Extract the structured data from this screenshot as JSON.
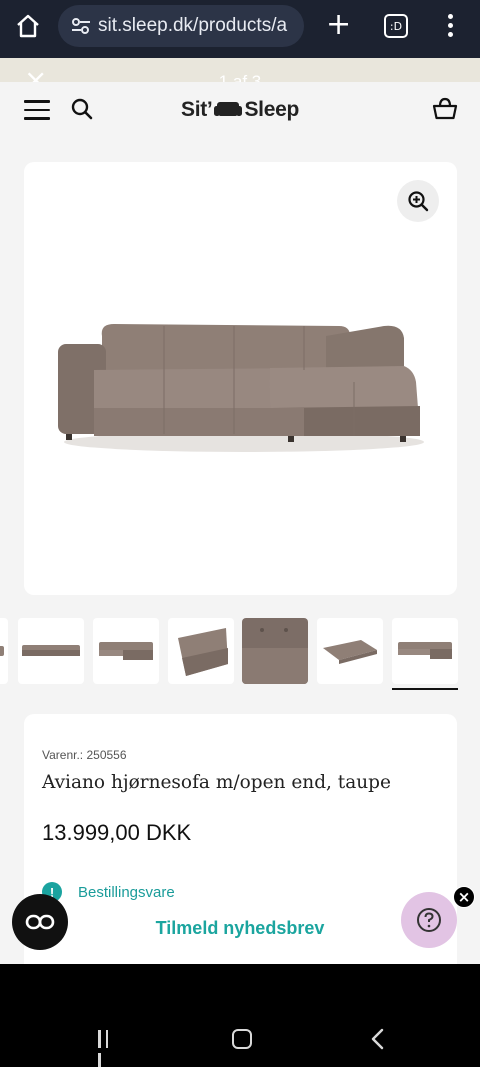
{
  "browser": {
    "url": "sit.sleep.dk/products/a",
    "tab_count": ":D"
  },
  "announcement": {
    "counter": "1 af 3"
  },
  "header": {
    "logo_left": "Sit’",
    "logo_right": "Sleep"
  },
  "product": {
    "sku": "Varenr.: 250556",
    "title": "Aviano hjørnesofa m/open end, taupe",
    "price": "13.999,00 DKK",
    "availability": "Bestillingsvare",
    "image_color": "#8f7f76",
    "thumbnail_count": 7,
    "selected_thumbnail": 7
  },
  "footer": {
    "newsletter": "Tilmeld nyhedsbrev"
  },
  "colors": {
    "accent": "#1ba59f",
    "help_bubble": "#e2c4e4"
  }
}
